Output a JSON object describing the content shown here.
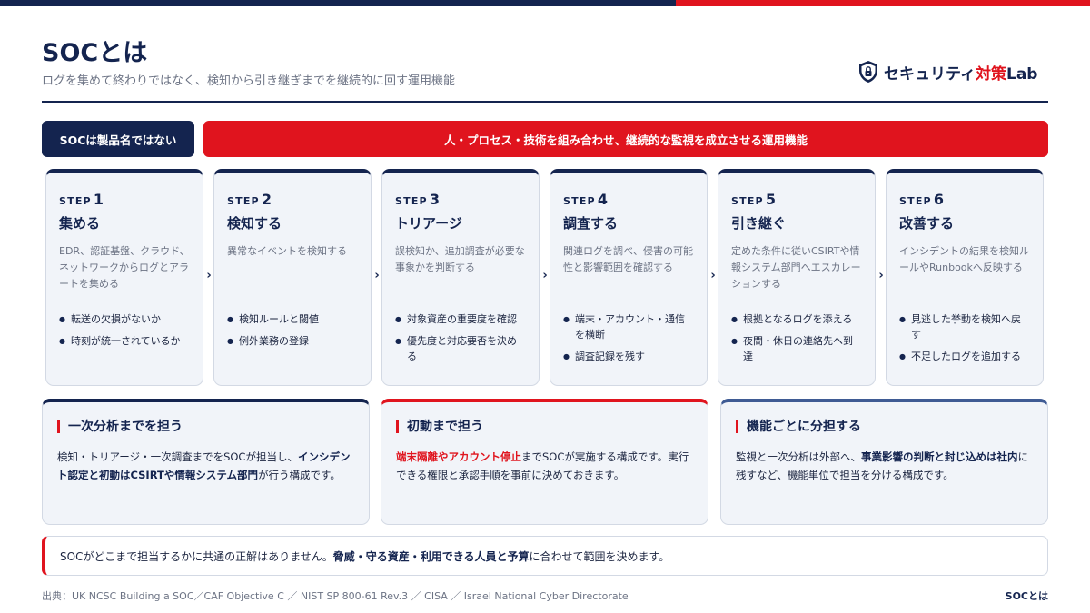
{
  "header": {
    "title": "SOCとは",
    "subtitle": "ログを集めて終わりではなく、検知から引き継ぎまでを継続的に回す運用機能"
  },
  "logo": {
    "name_main": "セキュリティ",
    "name_accent": "対策",
    "name_tail": "Lab",
    "icon": "shield-lock-icon"
  },
  "banner": {
    "left": "SOCは製品名ではない",
    "right": "人・プロセス・技術を組み合わせ、継続的な監視を成立させる運用機能"
  },
  "steps": [
    {
      "label": "STEP",
      "num": "1",
      "name": "集める",
      "desc": "EDR、認証基盤、クラウド、ネットワークからログとアラートを集める",
      "points": [
        "転送の欠損がないか",
        "時刻が統一されているか"
      ]
    },
    {
      "label": "STEP",
      "num": "2",
      "name": "検知する",
      "desc": "異常なイベントを検知する",
      "points": [
        "検知ルールと閾値",
        "例外業務の登録"
      ]
    },
    {
      "label": "STEP",
      "num": "3",
      "name": "トリアージ",
      "desc": "誤検知か、追加調査が必要な事象かを判断する",
      "points": [
        "対象資産の重要度を確認",
        "優先度と対応要否を決める"
      ]
    },
    {
      "label": "STEP",
      "num": "4",
      "name": "調査する",
      "desc": "関連ログを調べ、侵害の可能性と影響範囲を確認する",
      "points": [
        "端末・アカウント・通信を横断",
        "調査記録を残す"
      ]
    },
    {
      "label": "STEP",
      "num": "5",
      "name": "引き継ぐ",
      "desc": "定めた条件に従いCSIRTや情報システム部門へエスカレーションする",
      "points": [
        "根拠となるログを添える",
        "夜間・休日の連絡先へ到達"
      ]
    },
    {
      "label": "STEP",
      "num": "6",
      "name": "改善する",
      "desc": "インシデントの結果を検知ルールやRunbookへ反映する",
      "points": [
        "見逃した挙動を検知へ戻す",
        "不足したログを追加する"
      ]
    }
  ],
  "cards": [
    {
      "title": "一次分析までを担う",
      "parts": [
        "検知・トリアージ・一次調査までをSOCが担当し、",
        "インシデント認定と初動はCSIRTや情報システム部門",
        "が行う構成です。"
      ]
    },
    {
      "title": "初動まで担う",
      "parts": [
        "端末隔離やアカウント停止",
        "までSOCが実施する構成です。実行できる権限と承認手順を事前に決めておきます。"
      ]
    },
    {
      "title": "機能ごとに分担する",
      "parts": [
        "監視と一次分析は外部へ、",
        "事業影響の判断と封じ込めは社内",
        "に残すなど、機能単位で担当を分ける構成です。"
      ]
    }
  ],
  "note": {
    "pre": "SOCがどこまで担当するかに共通の正解はありません。",
    "bold": "脅威・守る資産・利用できる人員と予算",
    "post": "に合わせて範囲を決めます。"
  },
  "footer": {
    "source": "出典：UK NCSC Building a SOC／CAF Objective C ／ NIST SP 800-61 Rev.3 ／ CISA ／ Israel National Cyber Directorate",
    "page_tag": "SOCとは"
  },
  "colors": {
    "navy": "#14244f",
    "red": "#e0141e",
    "panel": "#f1f4f9",
    "muted": "#6c7384"
  }
}
